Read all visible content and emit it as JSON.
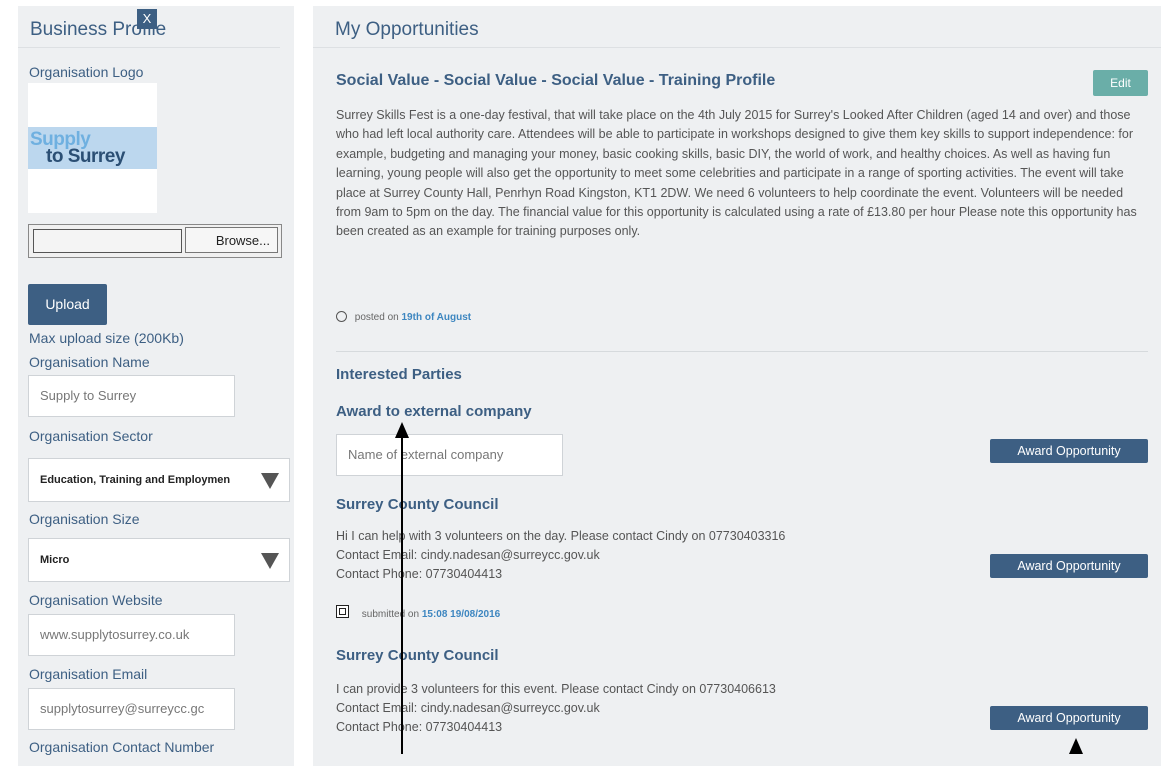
{
  "left": {
    "title": "Business Profile",
    "logo_label": "Organisation Logo",
    "logo_text_1": "Supply",
    "logo_text_2": "to Surrey",
    "logo_remove": "X",
    "browse_label": "Browse...",
    "upload_label": "Upload",
    "max_upload": "Max upload size (200Kb)",
    "name_label": "Organisation Name",
    "name_value": "Supply to Surrey",
    "sector_label": "Organisation Sector",
    "sector_value": "Education, Training and Employmen",
    "size_label": "Organisation Size",
    "size_value": "Micro",
    "website_label": "Organisation Website",
    "website_value": "www.supplytosurrey.co.uk",
    "email_label": "Organisation Email",
    "email_value": "supplytosurrey@surreycc.gc",
    "contact_label": "Organisation Contact Number"
  },
  "right": {
    "title": "My Opportunities",
    "opportunity_title": "Social Value - Social Value - Social Value - Training Profile",
    "edit_label": "Edit",
    "description": "Surrey Skills Fest is a one-day festival, that will take place on the 4th July 2015 for Surrey's Looked After Children (aged 14 and over) and those who had left local authority care. Attendees will be able to participate in workshops designed to give them key skills to support independence: for example, budgeting and managing your money, basic cooking skills, basic DIY, the world of work, and healthy choices. As well as having fun learning, young people will also get the opportunity to meet some celebrities and participate in a range of sporting activities. The event will take place at Surrey County Hall, Penrhyn Road Kingston, KT1 2DW. We need 6 volunteers to help coordinate the event. Volunteers will be needed from 9am to 5pm on the day. The financial value for this opportunity is calculated using a rate of £13.80 per hour Please note this opportunity has been created as an example for training purposes only.",
    "posted_prefix": "posted on",
    "posted_date": "19th of August",
    "interested_heading": "Interested Parties",
    "award_external_heading": "Award to external company",
    "external_placeholder": "Name of external company",
    "award_label": "Award Opportunity",
    "parties": [
      {
        "name": "Surrey County Council",
        "message": "Hi I can help with 3 volunteers on the day. Please contact Cindy on 07730403316",
        "email": "Contact Email: cindy.nadesan@surreycc.gov.uk",
        "phone": "Contact Phone: 07730404413",
        "submitted_prefix": "submitted on",
        "submitted_date": "15:08 19/08/2016"
      },
      {
        "name": "Surrey County Council",
        "message": "I can provide 3 volunteers for this event. Please contact Cindy on 07730406613",
        "email": "Contact Email: cindy.nadesan@surreycc.gov.uk",
        "phone": "Contact Phone: 07730404413"
      }
    ]
  }
}
